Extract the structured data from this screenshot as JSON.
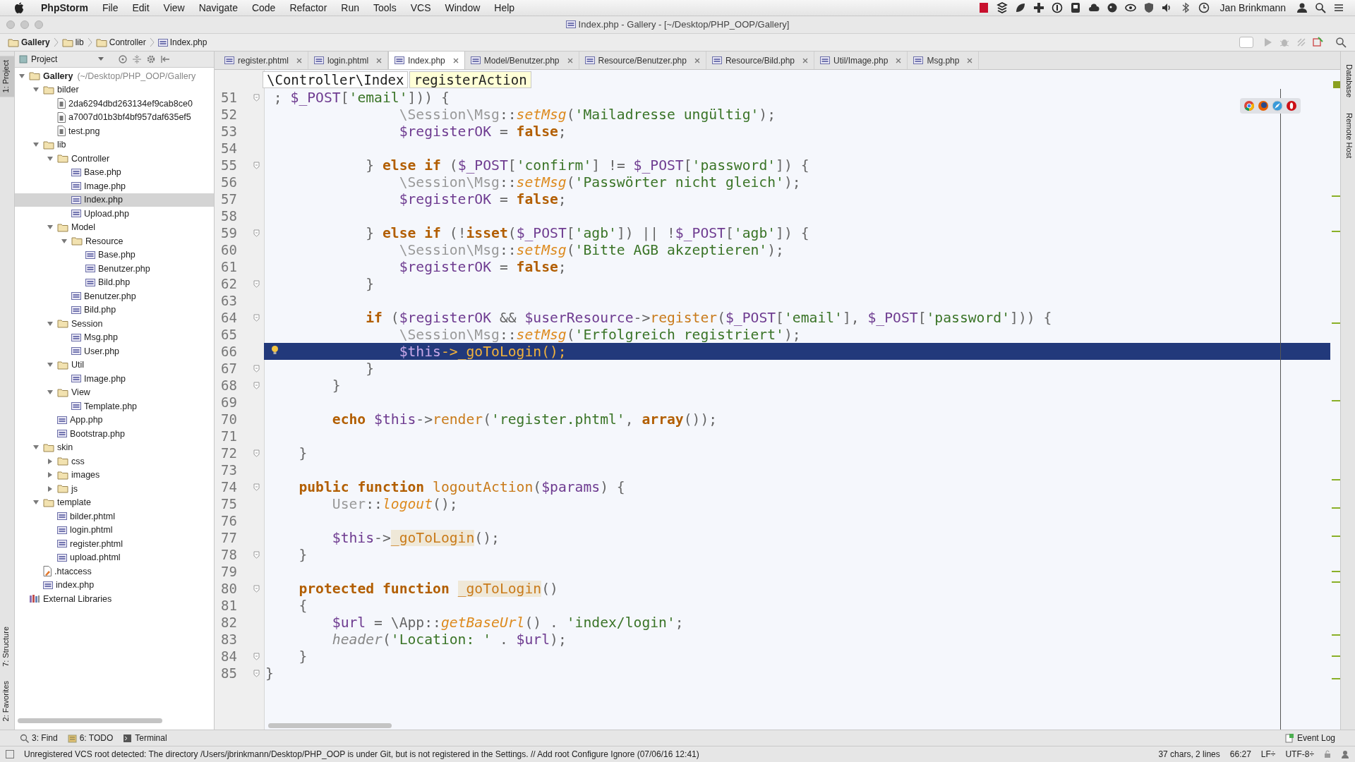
{
  "menu_bar": {
    "app": "PhpStorm",
    "items": [
      "File",
      "Edit",
      "View",
      "Navigate",
      "Code",
      "Refactor",
      "Run",
      "Tools",
      "VCS",
      "Window",
      "Help"
    ],
    "user": "Jan Brinkmann"
  },
  "window": {
    "title": "Index.php - Gallery - [~/Desktop/PHP_OOP/Gallery]"
  },
  "nav_bar": {
    "breadcrumbs": [
      {
        "label": "Gallery",
        "kind": "folder"
      },
      {
        "label": "lib",
        "kind": "folder"
      },
      {
        "label": "Controller",
        "kind": "folder"
      },
      {
        "label": "Index.php",
        "kind": "php"
      }
    ]
  },
  "left_tool_strip": {
    "top": [
      {
        "label": "1: Project",
        "selected": true
      }
    ],
    "bottom": [
      {
        "label": "7: Structure",
        "selected": false
      },
      {
        "label": "2: Favorites",
        "selected": false
      }
    ]
  },
  "right_tool_strip": [
    {
      "label": "Database"
    },
    {
      "label": "Remote Host"
    }
  ],
  "project_panel": {
    "view": "Project",
    "tree": [
      {
        "label": "Gallery",
        "path": "(~/Desktop/PHP_OOP/Gallery",
        "kind": "folder",
        "expanded": true,
        "selected": false,
        "children": [
          {
            "label": "bilder",
            "kind": "folder",
            "expanded": true,
            "selected": false,
            "children": [
              {
                "label": "2da6294dbd263134ef9cab8ce0",
                "kind": "file",
                "selected": false
              },
              {
                "label": "a7007d01b3bf4bf957daf635ef5",
                "kind": "file",
                "selected": false
              },
              {
                "label": "test.png",
                "kind": "file",
                "selected": false
              }
            ]
          },
          {
            "label": "lib",
            "kind": "folder",
            "expanded": true,
            "selected": false,
            "children": [
              {
                "label": "Controller",
                "kind": "folder",
                "expanded": true,
                "selected": false,
                "children": [
                  {
                    "label": "Base.php",
                    "kind": "php",
                    "selected": false
                  },
                  {
                    "label": "Image.php",
                    "kind": "php",
                    "selected": false
                  },
                  {
                    "label": "Index.php",
                    "kind": "php",
                    "selected": true
                  },
                  {
                    "label": "Upload.php",
                    "kind": "php",
                    "selected": false
                  }
                ]
              },
              {
                "label": "Model",
                "kind": "folder",
                "expanded": true,
                "selected": false,
                "children": [
                  {
                    "label": "Resource",
                    "kind": "folder",
                    "expanded": true,
                    "selected": false,
                    "children": [
                      {
                        "label": "Base.php",
                        "kind": "php",
                        "selected": false
                      },
                      {
                        "label": "Benutzer.php",
                        "kind": "php",
                        "selected": false
                      },
                      {
                        "label": "Bild.php",
                        "kind": "php",
                        "selected": false
                      }
                    ]
                  },
                  {
                    "label": "Benutzer.php",
                    "kind": "php",
                    "selected": false
                  },
                  {
                    "label": "Bild.php",
                    "kind": "php",
                    "selected": false
                  }
                ]
              },
              {
                "label": "Session",
                "kind": "folder",
                "expanded": true,
                "selected": false,
                "children": [
                  {
                    "label": "Msg.php",
                    "kind": "php",
                    "selected": false
                  },
                  {
                    "label": "User.php",
                    "kind": "php",
                    "selected": false
                  }
                ]
              },
              {
                "label": "Util",
                "kind": "folder",
                "expanded": true,
                "selected": false,
                "children": [
                  {
                    "label": "Image.php",
                    "kind": "php",
                    "selected": false
                  }
                ]
              },
              {
                "label": "View",
                "kind": "folder",
                "expanded": true,
                "selected": false,
                "children": [
                  {
                    "label": "Template.php",
                    "kind": "php",
                    "selected": false
                  }
                ]
              },
              {
                "label": "App.php",
                "kind": "php",
                "selected": false
              },
              {
                "label": "Bootstrap.php",
                "kind": "php",
                "selected": false
              }
            ]
          },
          {
            "label": "skin",
            "kind": "folder",
            "expanded": true,
            "selected": false,
            "children": [
              {
                "label": "css",
                "kind": "folder",
                "expanded": false,
                "selected": false
              },
              {
                "label": "images",
                "kind": "folder",
                "expanded": false,
                "selected": false
              },
              {
                "label": "js",
                "kind": "folder",
                "expanded": false,
                "selected": false
              }
            ]
          },
          {
            "label": "template",
            "kind": "folder",
            "expanded": true,
            "selected": false,
            "children": [
              {
                "label": "bilder.phtml",
                "kind": "php",
                "selected": false
              },
              {
                "label": "login.phtml",
                "kind": "php",
                "selected": false
              },
              {
                "label": "register.phtml",
                "kind": "php",
                "selected": false
              },
              {
                "label": "upload.phtml",
                "kind": "php",
                "selected": false
              }
            ]
          },
          {
            "label": ".htaccess",
            "kind": "config",
            "selected": false
          },
          {
            "label": "index.php",
            "kind": "php",
            "selected": false
          }
        ]
      },
      {
        "label": "External Libraries",
        "kind": "library",
        "selected": false
      }
    ]
  },
  "editor": {
    "tabs": [
      {
        "label": "register.phtml",
        "selected": false
      },
      {
        "label": "login.phtml",
        "selected": false
      },
      {
        "label": "Index.php",
        "selected": true
      },
      {
        "label": "Model/Benutzer.php",
        "selected": false
      },
      {
        "label": "Resource/Benutzer.php",
        "selected": false
      },
      {
        "label": "Resource/Bild.php",
        "selected": false
      },
      {
        "label": "Util/Image.php",
        "selected": false
      },
      {
        "label": "Msg.php",
        "selected": false
      }
    ],
    "breadcrumb": [
      {
        "label": "\\Controller\\Index",
        "kind": "class"
      },
      {
        "label": "registerAction",
        "kind": "method"
      }
    ],
    "lines": [
      {
        "number": "51",
        "fold": true,
        "current": false,
        "tokens": [
          {
            "kind": "plain",
            "text": " ; "
          },
          {
            "kind": "variable",
            "text": "$_POST"
          },
          {
            "kind": "plain",
            "text": "["
          },
          {
            "kind": "string",
            "text": "'email'"
          },
          {
            "kind": "plain",
            "text": "])) {"
          }
        ]
      },
      {
        "number": "52",
        "fold": false,
        "current": false,
        "tokens": [
          {
            "kind": "namespace",
            "text": "                \\Session\\Msg"
          },
          {
            "kind": "plain",
            "text": "::"
          },
          {
            "kind": "static",
            "text": "setMsg"
          },
          {
            "kind": "plain",
            "text": "("
          },
          {
            "kind": "string",
            "text": "'Mailadresse ungültig'"
          },
          {
            "kind": "plain",
            "text": ");"
          }
        ]
      },
      {
        "number": "53",
        "fold": false,
        "current": false,
        "tokens": [
          {
            "kind": "variable",
            "text": "                $registerOK"
          },
          {
            "kind": "plain",
            "text": " = "
          },
          {
            "kind": "keyword",
            "text": "false"
          },
          {
            "kind": "plain",
            "text": ";"
          }
        ]
      },
      {
        "number": "54",
        "fold": false,
        "current": false
      },
      {
        "number": "55",
        "fold": true,
        "current": false,
        "tokens": [
          {
            "kind": "plain",
            "text": "            } "
          },
          {
            "kind": "keyword",
            "text": "else if"
          },
          {
            "kind": "plain",
            "text": " ("
          },
          {
            "kind": "variable",
            "text": "$_POST"
          },
          {
            "kind": "plain",
            "text": "["
          },
          {
            "kind": "string",
            "text": "'confirm'"
          },
          {
            "kind": "plain",
            "text": "] != "
          },
          {
            "kind": "variable",
            "text": "$_POST"
          },
          {
            "kind": "plain",
            "text": "["
          },
          {
            "kind": "string",
            "text": "'password'"
          },
          {
            "kind": "plain",
            "text": "]) {"
          }
        ]
      },
      {
        "number": "56",
        "fold": false,
        "current": false,
        "tokens": [
          {
            "kind": "namespace",
            "text": "                \\Session\\Msg"
          },
          {
            "kind": "plain",
            "text": "::"
          },
          {
            "kind": "static",
            "text": "setMsg"
          },
          {
            "kind": "plain",
            "text": "("
          },
          {
            "kind": "string",
            "text": "'Passwörter nicht gleich'"
          },
          {
            "kind": "plain",
            "text": ");"
          }
        ]
      },
      {
        "number": "57",
        "fold": false,
        "current": false,
        "tokens": [
          {
            "kind": "variable",
            "text": "                $registerOK"
          },
          {
            "kind": "plain",
            "text": " = "
          },
          {
            "kind": "keyword",
            "text": "false"
          },
          {
            "kind": "plain",
            "text": ";"
          }
        ]
      },
      {
        "number": "58",
        "fold": false,
        "current": false
      },
      {
        "number": "59",
        "fold": true,
        "current": false,
        "tokens": [
          {
            "kind": "plain",
            "text": "            } "
          },
          {
            "kind": "keyword",
            "text": "else if"
          },
          {
            "kind": "plain",
            "text": " (!"
          },
          {
            "kind": "keyword",
            "text": "isset"
          },
          {
            "kind": "plain",
            "text": "("
          },
          {
            "kind": "variable",
            "text": "$_POST"
          },
          {
            "kind": "plain",
            "text": "["
          },
          {
            "kind": "string",
            "text": "'agb'"
          },
          {
            "kind": "plain",
            "text": "]) || !"
          },
          {
            "kind": "variable",
            "text": "$_POST"
          },
          {
            "kind": "plain",
            "text": "["
          },
          {
            "kind": "string",
            "text": "'agb'"
          },
          {
            "kind": "plain",
            "text": "]) {"
          }
        ]
      },
      {
        "number": "60",
        "fold": false,
        "current": false,
        "tokens": [
          {
            "kind": "namespace",
            "text": "                \\Session\\Msg"
          },
          {
            "kind": "plain",
            "text": "::"
          },
          {
            "kind": "static",
            "text": "setMsg"
          },
          {
            "kind": "plain",
            "text": "("
          },
          {
            "kind": "string",
            "text": "'Bitte AGB akzeptieren'"
          },
          {
            "kind": "plain",
            "text": ");"
          }
        ]
      },
      {
        "number": "61",
        "fold": false,
        "current": false,
        "tokens": [
          {
            "kind": "variable",
            "text": "                $registerOK"
          },
          {
            "kind": "plain",
            "text": " = "
          },
          {
            "kind": "keyword",
            "text": "false"
          },
          {
            "kind": "plain",
            "text": ";"
          }
        ]
      },
      {
        "number": "62",
        "fold": true,
        "current": false,
        "tokens": [
          {
            "kind": "plain",
            "text": "            }"
          }
        ]
      },
      {
        "number": "63",
        "fold": false,
        "current": false
      },
      {
        "number": "64",
        "fold": true,
        "current": false,
        "tokens": [
          {
            "kind": "keyword",
            "text": "            if"
          },
          {
            "kind": "plain",
            "text": " ("
          },
          {
            "kind": "variable",
            "text": "$registerOK"
          },
          {
            "kind": "plain",
            "text": " && "
          },
          {
            "kind": "variable",
            "text": "$userResource"
          },
          {
            "kind": "plain",
            "text": "->"
          },
          {
            "kind": "call",
            "text": "register"
          },
          {
            "kind": "plain",
            "text": "("
          },
          {
            "kind": "variable",
            "text": "$_POST"
          },
          {
            "kind": "plain",
            "text": "["
          },
          {
            "kind": "string",
            "text": "'email'"
          },
          {
            "kind": "plain",
            "text": "], "
          },
          {
            "kind": "variable",
            "text": "$_POST"
          },
          {
            "kind": "plain",
            "text": "["
          },
          {
            "kind": "string",
            "text": "'password'"
          },
          {
            "kind": "plain",
            "text": "])) {"
          }
        ]
      },
      {
        "number": "65",
        "fold": false,
        "current": false,
        "tokens": [
          {
            "kind": "namespace",
            "text": "                \\Session\\Msg"
          },
          {
            "kind": "plain",
            "text": "::"
          },
          {
            "kind": "static",
            "text": "setMsg"
          },
          {
            "kind": "plain",
            "text": "("
          },
          {
            "kind": "string",
            "text": "'Erfolgreich registriert'"
          },
          {
            "kind": "plain",
            "text": ");"
          }
        ]
      },
      {
        "number": "66",
        "fold": false,
        "current": true,
        "tokens": [
          {
            "kind": "variable",
            "text": "                $this"
          },
          {
            "kind": "plain",
            "text": "->"
          },
          {
            "kind": "call",
            "text": "_goToLogin"
          },
          {
            "kind": "plain",
            "text": "();"
          }
        ]
      },
      {
        "number": "67",
        "fold": true,
        "current": false,
        "tokens": [
          {
            "kind": "plain",
            "text": "            }"
          }
        ]
      },
      {
        "number": "68",
        "fold": true,
        "current": false,
        "tokens": [
          {
            "kind": "plain",
            "text": "        }"
          }
        ]
      },
      {
        "number": "69",
        "fold": false,
        "current": false
      },
      {
        "number": "70",
        "fold": false,
        "current": false,
        "tokens": [
          {
            "kind": "keyword",
            "text": "        echo "
          },
          {
            "kind": "variable",
            "text": "$this"
          },
          {
            "kind": "plain",
            "text": "->"
          },
          {
            "kind": "call",
            "text": "render"
          },
          {
            "kind": "plain",
            "text": "("
          },
          {
            "kind": "string",
            "text": "'register.phtml'"
          },
          {
            "kind": "plain",
            "text": ", "
          },
          {
            "kind": "keyword",
            "text": "array"
          },
          {
            "kind": "plain",
            "text": "());"
          }
        ]
      },
      {
        "number": "71",
        "fold": false,
        "current": false
      },
      {
        "number": "72",
        "fold": true,
        "current": false,
        "tokens": [
          {
            "kind": "plain",
            "text": "    }"
          }
        ]
      },
      {
        "number": "73",
        "fold": false,
        "current": false
      },
      {
        "number": "74",
        "fold": true,
        "current": false,
        "tokens": [
          {
            "kind": "keyword",
            "text": "    public function "
          },
          {
            "kind": "call",
            "text": "logoutAction"
          },
          {
            "kind": "plain",
            "text": "("
          },
          {
            "kind": "variable",
            "text": "$params"
          },
          {
            "kind": "plain",
            "text": ") {"
          }
        ]
      },
      {
        "number": "75",
        "fold": false,
        "current": false,
        "tokens": [
          {
            "kind": "namespace",
            "text": "        User"
          },
          {
            "kind": "plain",
            "text": "::"
          },
          {
            "kind": "static",
            "text": "logout"
          },
          {
            "kind": "plain",
            "text": "();"
          }
        ]
      },
      {
        "number": "76",
        "fold": false,
        "current": false
      },
      {
        "number": "77",
        "fold": false,
        "current": false,
        "tokens": [
          {
            "kind": "variable",
            "text": "        $this"
          },
          {
            "kind": "plain",
            "text": "->"
          },
          {
            "kind": "usage",
            "text": "_goToLogin"
          },
          {
            "kind": "plain",
            "text": "();"
          }
        ]
      },
      {
        "number": "78",
        "fold": true,
        "current": false,
        "tokens": [
          {
            "kind": "plain",
            "text": "    }"
          }
        ]
      },
      {
        "number": "79",
        "fold": false,
        "current": false
      },
      {
        "number": "80",
        "fold": true,
        "current": false,
        "tokens": [
          {
            "kind": "keyword",
            "text": "    protected function "
          },
          {
            "kind": "usage",
            "text": "_goToLogin"
          },
          {
            "kind": "plain",
            "text": "()"
          }
        ]
      },
      {
        "number": "81",
        "fold": false,
        "current": false,
        "tokens": [
          {
            "kind": "plain",
            "text": "    {"
          }
        ]
      },
      {
        "number": "82",
        "fold": false,
        "current": false,
        "tokens": [
          {
            "kind": "variable",
            "text": "        $url"
          },
          {
            "kind": "plain",
            "text": " = \\App::"
          },
          {
            "kind": "static",
            "text": "getBaseUrl"
          },
          {
            "kind": "plain",
            "text": "() . "
          },
          {
            "kind": "string",
            "text": "'index/login'"
          },
          {
            "kind": "plain",
            "text": ";"
          }
        ]
      },
      {
        "number": "83",
        "fold": false,
        "current": false,
        "tokens": [
          {
            "kind": "builtin",
            "text": "        header"
          },
          {
            "kind": "plain",
            "text": "("
          },
          {
            "kind": "string",
            "text": "'Location: '"
          },
          {
            "kind": "plain",
            "text": " . "
          },
          {
            "kind": "variable",
            "text": "$url"
          },
          {
            "kind": "plain",
            "text": ");"
          }
        ]
      },
      {
        "number": "84",
        "fold": true,
        "current": false,
        "tokens": [
          {
            "kind": "plain",
            "text": "    }"
          }
        ]
      },
      {
        "number": "85",
        "fold": true,
        "current": false,
        "tokens": [
          {
            "kind": "plain",
            "text": "}"
          }
        ]
      }
    ]
  },
  "tool_window_bar": {
    "left": [
      {
        "label": "3: Find",
        "kind": "find"
      },
      {
        "label": "6: TODO",
        "kind": "todo"
      },
      {
        "label": "Terminal",
        "kind": "terminal"
      }
    ],
    "right": {
      "label": "Event Log"
    }
  },
  "status_bar": {
    "message": "Unregistered VCS root detected: The directory /Users/jbrinkmann/Desktop/PHP_OOP is under Git, but is not registered in the Settings. // Add root  Configure  Ignore (07/06/16 12:41)",
    "selection": "37 chars, 2 lines",
    "position": "66:27",
    "line_separator": "LF÷",
    "encoding": "UTF-8÷"
  }
}
